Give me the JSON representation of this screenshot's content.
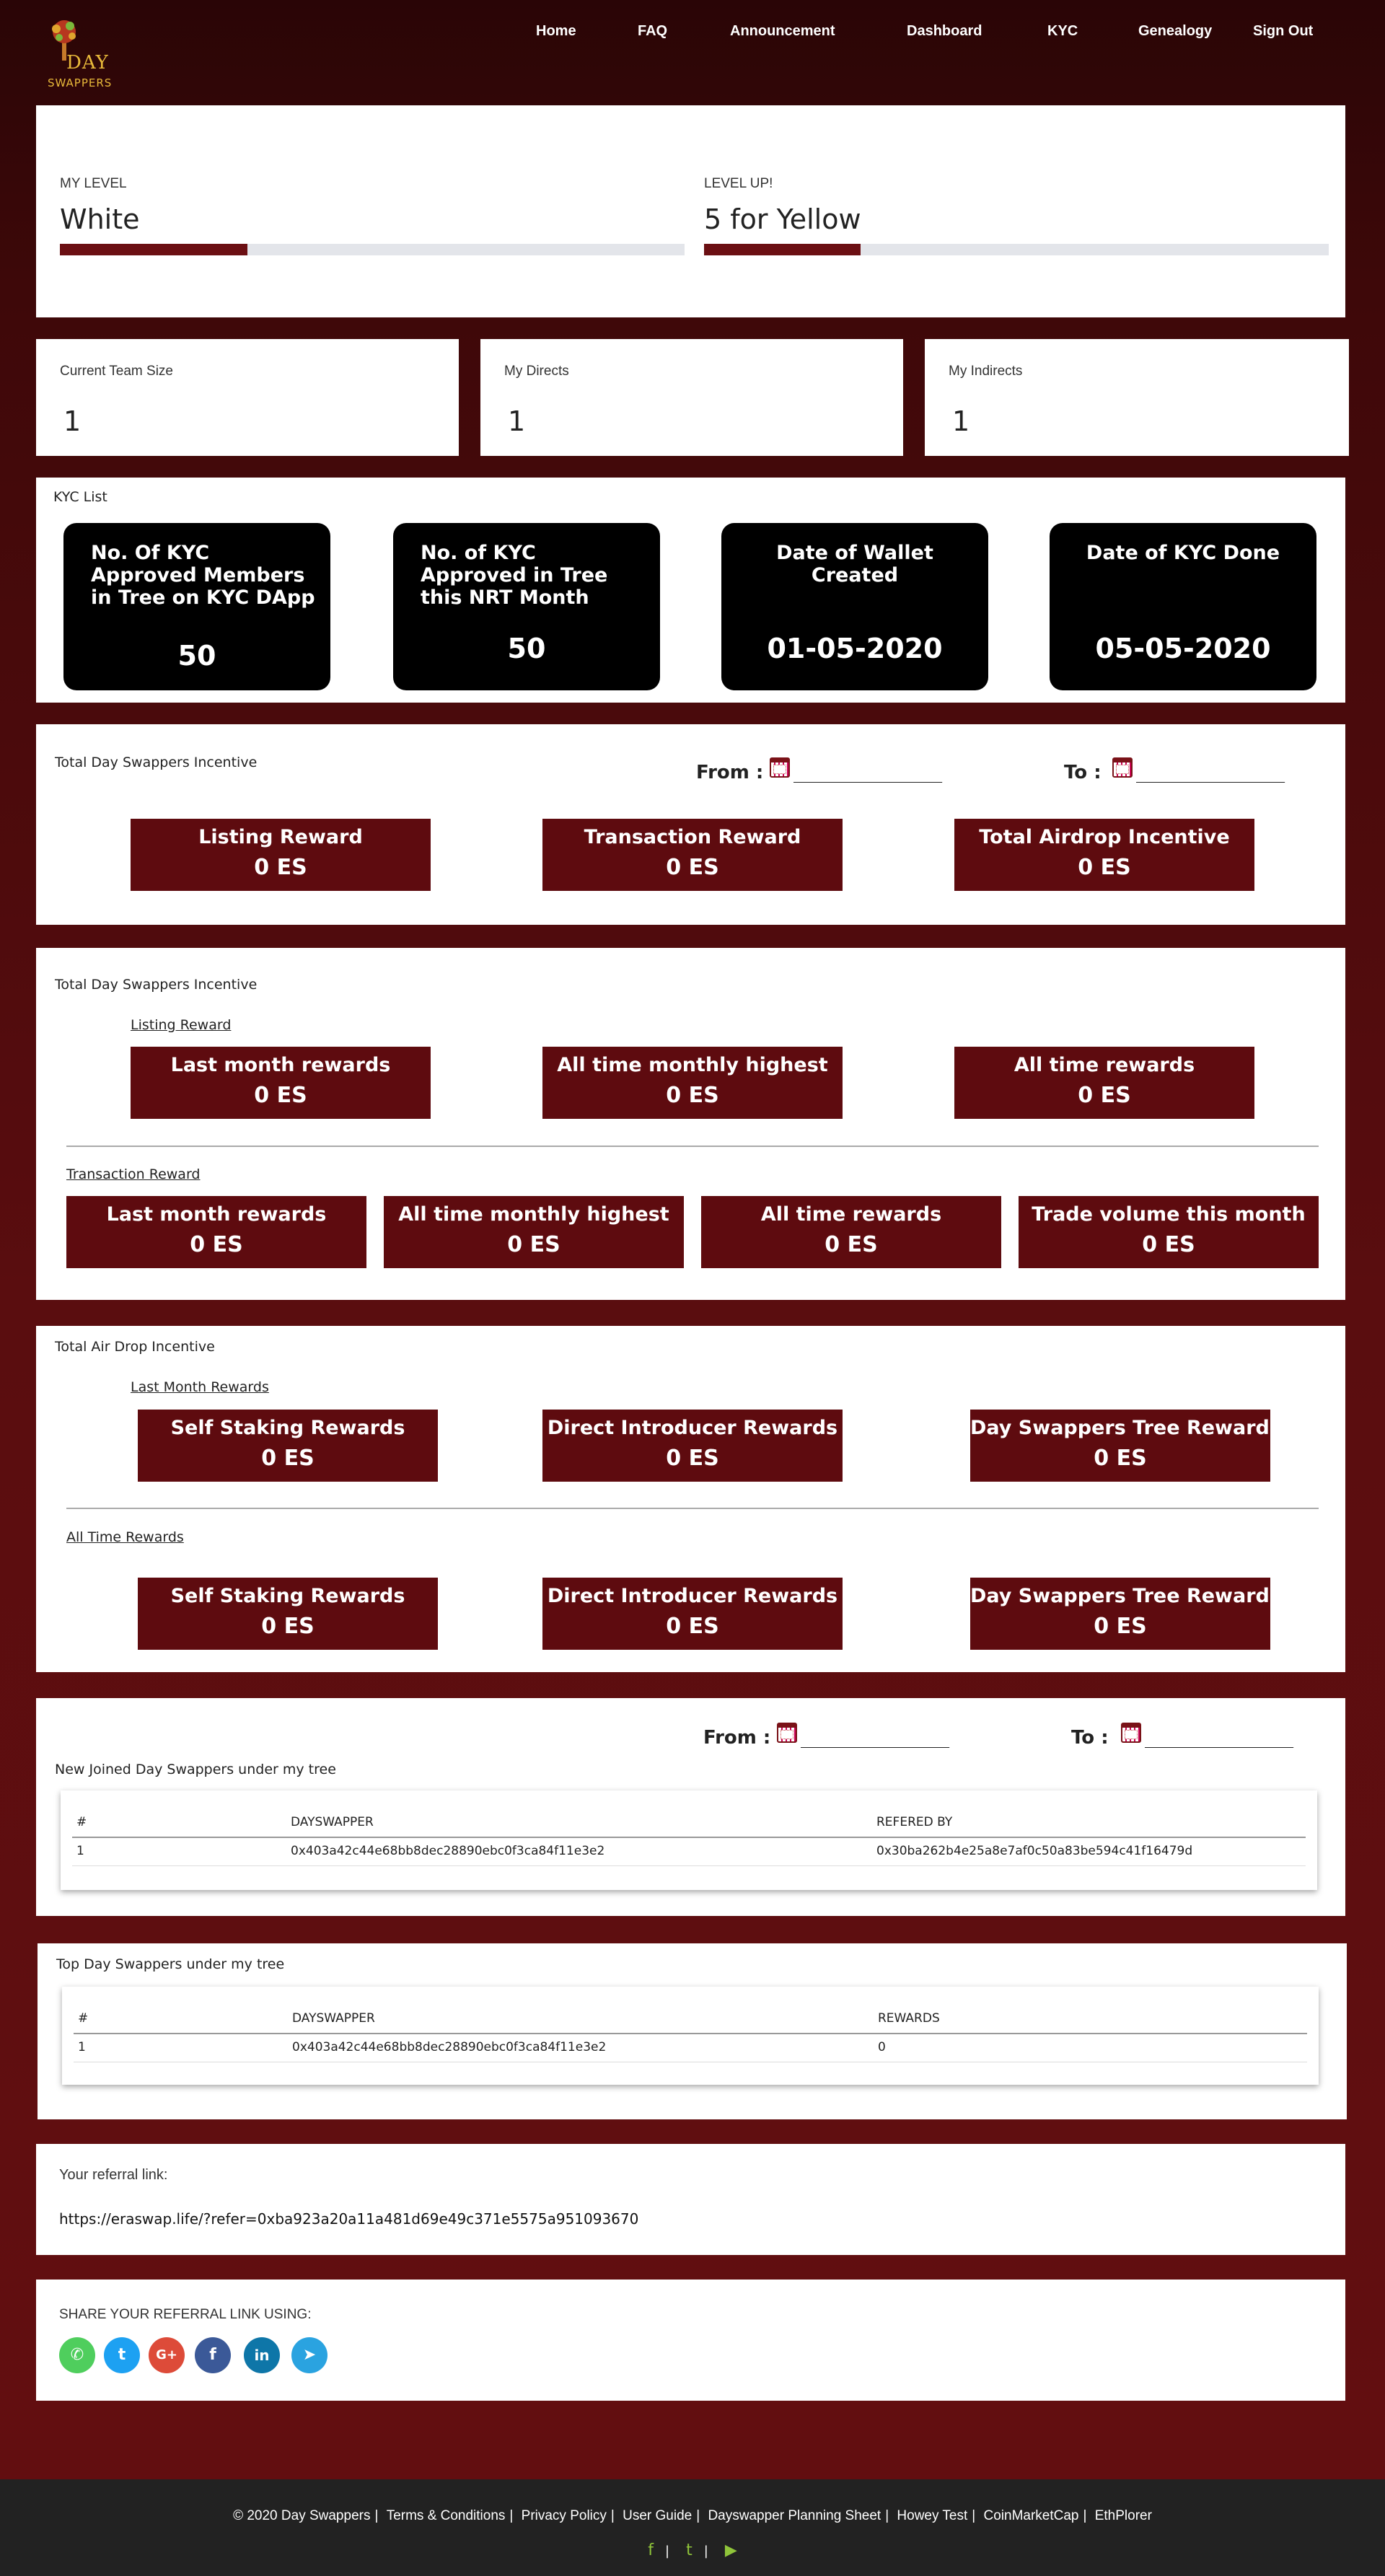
{
  "logo": {
    "line1": "DAY",
    "line2": "SWAPPERS"
  },
  "nav": {
    "items": [
      "Home",
      "FAQ",
      "Announcement",
      "Dashboard",
      "KYC",
      "Genealogy",
      "Sign Out"
    ]
  },
  "level": {
    "my_level_label": "MY LEVEL",
    "my_level_value": "White",
    "my_level_progress": 0.3,
    "level_up_label": "LEVEL UP!",
    "level_up_value": "5 for Yellow",
    "level_up_progress": 0.25
  },
  "stats": [
    {
      "label": "Current Team Size",
      "value": "1"
    },
    {
      "label": "My Directs",
      "value": "1"
    },
    {
      "label": "My Indirects",
      "value": "1"
    }
  ],
  "kyc": {
    "title": "KYC List",
    "tiles": [
      {
        "label": "No. Of KYC Approved Members in Tree on KYC DApp",
        "value": "50"
      },
      {
        "label": "No. of KYC Approved in Tree this NRT Month",
        "value": "50"
      },
      {
        "label": "Date of Wallet Created",
        "value": "01-05-2020"
      },
      {
        "label": "Date of KYC Done",
        "value": "05-05-2020"
      }
    ]
  },
  "incentive_summary": {
    "title": "Total Day Swappers Incentive",
    "from_label": "From :",
    "to_label": "To :",
    "date_placeholder": "______________",
    "boxes": [
      {
        "label": "Listing Reward",
        "value": "0 ES"
      },
      {
        "label": "Transaction Reward",
        "value": "0 ES"
      },
      {
        "label": "Total Airdrop Incentive",
        "value": "0 ES"
      }
    ]
  },
  "incentive_detail": {
    "title": "Total Day Swappers Incentive",
    "listing_title": "Listing Reward",
    "listing_boxes": [
      {
        "label": "Last month rewards",
        "value": "0 ES"
      },
      {
        "label": "All time monthly highest",
        "value": "0 ES"
      },
      {
        "label": "All time rewards",
        "value": "0 ES"
      }
    ],
    "transaction_title": "Transaction Reward",
    "transaction_boxes": [
      {
        "label": "Last month rewards",
        "value": "0 ES"
      },
      {
        "label": "All time monthly highest",
        "value": "0 ES"
      },
      {
        "label": "All time rewards",
        "value": "0 ES"
      },
      {
        "label": "Trade volume this month",
        "value": "0 ES"
      }
    ]
  },
  "airdrop": {
    "title": "Total Air Drop Incentive",
    "last_month_title": "Last Month Rewards",
    "last_month_boxes": [
      {
        "label": "Self Staking Rewards",
        "value": "0 ES"
      },
      {
        "label": "Direct Introducer Rewards",
        "value": "0 ES"
      },
      {
        "label": "Day Swappers Tree Rewards",
        "value": "0 ES"
      }
    ],
    "all_time_title": "All Time Rewards",
    "all_time_boxes": [
      {
        "label": "Self Staking Rewards",
        "value": "0 ES"
      },
      {
        "label": "Direct Introducer Rewards",
        "value": "0 ES"
      },
      {
        "label": "Day Swappers Tree Rewards",
        "value": "0 ES"
      }
    ]
  },
  "new_joined": {
    "from_label": "From :",
    "to_label": "To :",
    "date_placeholder": "______________",
    "title": "New Joined Day Swappers under my tree",
    "headers": [
      "#",
      "DAYSWAPPER",
      "REFERED BY"
    ],
    "rows": [
      [
        "1",
        "0x403a42c44e68bb8dec28890ebc0f3ca84f11e3e2",
        "0x30ba262b4e25a8e7af0c50a83be594c41f16479d"
      ]
    ]
  },
  "top_swappers": {
    "title": "Top Day Swappers under my tree",
    "headers": [
      "#",
      "DAYSWAPPER",
      "REWARDS"
    ],
    "rows": [
      [
        "1",
        "0x403a42c44e68bb8dec28890ebc0f3ca84f11e3e2",
        "0"
      ]
    ]
  },
  "referral": {
    "label": "Your referral link:",
    "link": "https://eraswap.life/?refer=0xba923a20a11a481d69e49c371e5575a951093670"
  },
  "share": {
    "label": "SHARE YOUR REFERRAL LINK USING:",
    "icons": [
      {
        "name": "whatsapp-icon",
        "glyph": "✆",
        "color": "#4fce5d"
      },
      {
        "name": "twitter-icon",
        "glyph": "t",
        "color": "#1da1f2"
      },
      {
        "name": "google-plus-icon",
        "glyph": "G+",
        "color": "#dd4b39"
      },
      {
        "name": "facebook-icon",
        "glyph": "f",
        "color": "#3b5998"
      },
      {
        "name": "linkedin-icon",
        "glyph": "in",
        "color": "#0e76a8"
      },
      {
        "name": "telegram-icon",
        "glyph": "➤",
        "color": "#2aa3e0"
      }
    ]
  },
  "footer": {
    "copyright": "© 2020 Day Swappers",
    "links": [
      "Terms & Conditions",
      "Privacy Policy",
      "User Guide",
      "Dayswapper Planning Sheet",
      "Howey Test",
      "CoinMarketCap",
      "EthPlorer"
    ],
    "icons": [
      "f",
      "t",
      "▶"
    ]
  },
  "colors": {
    "maroon": "#5e0b0f",
    "bar": "#6b0f13",
    "accent_green": "#8fc43a"
  }
}
